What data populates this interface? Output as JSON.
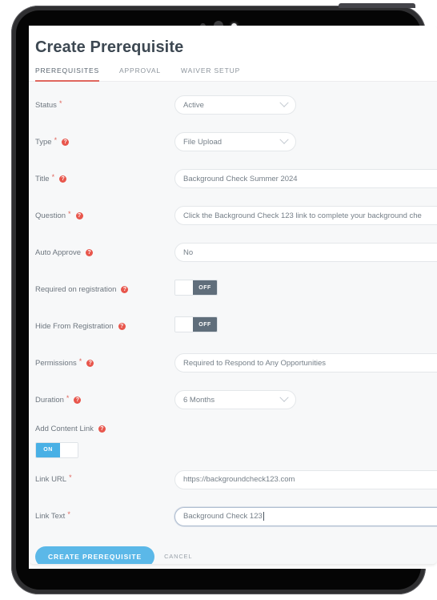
{
  "device": {
    "type": "tablet",
    "bezel_color": "#2f2f31",
    "buttons": [
      "power",
      "volume-up",
      "volume-down"
    ]
  },
  "header": {
    "title": "Create Prerequisite",
    "accent_color": "#e0675e"
  },
  "tabs": [
    {
      "label": "PREREQUISITES",
      "active": true
    },
    {
      "label": "APPROVAL",
      "active": false
    },
    {
      "label": "WAIVER SETUP",
      "active": false
    }
  ],
  "fields": {
    "status": {
      "label": "Status",
      "required": true,
      "has_help": false,
      "value": "Active",
      "control": "select"
    },
    "type": {
      "label": "Type",
      "required": true,
      "has_help": true,
      "value": "File Upload",
      "control": "select"
    },
    "title": {
      "label": "Title",
      "required": true,
      "has_help": true,
      "value": "Background Check Summer 2024",
      "control": "text"
    },
    "question": {
      "label": "Question",
      "required": true,
      "has_help": true,
      "value": "Click the Background Check 123 link to complete your background che",
      "control": "text"
    },
    "auto_approve": {
      "label": "Auto Approve",
      "required": false,
      "has_help": true,
      "value": "No",
      "control": "select"
    },
    "required_on_registration": {
      "label": "Required on registration",
      "required": false,
      "has_help": true,
      "value": "OFF",
      "control": "toggle",
      "state": "off"
    },
    "hide_from_registration": {
      "label": "Hide From Registration",
      "required": false,
      "has_help": true,
      "value": "OFF",
      "control": "toggle",
      "state": "off"
    },
    "permissions": {
      "label": "Permissions",
      "required": true,
      "has_help": true,
      "value": "Required to Respond to Any Opportunities",
      "control": "select"
    },
    "duration": {
      "label": "Duration",
      "required": true,
      "has_help": true,
      "value": "6 Months",
      "control": "select"
    },
    "add_content_link": {
      "label": "Add Content Link",
      "required": false,
      "has_help": true,
      "value": "ON",
      "control": "toggle",
      "state": "on"
    },
    "link_url": {
      "label": "Link URL",
      "required": true,
      "has_help": false,
      "value": "https://backgroundcheck123.com",
      "control": "text"
    },
    "link_text": {
      "label": "Link Text",
      "required": true,
      "has_help": false,
      "value": "Background Check 123",
      "control": "text",
      "focused": true
    }
  },
  "actions": {
    "submit_label": "CREATE PREREQUISITE",
    "cancel_label": "CANCEL",
    "submit_color": "#5bb8e8"
  },
  "icons": {
    "help": "?",
    "chevron": "chevron-down-icon"
  }
}
